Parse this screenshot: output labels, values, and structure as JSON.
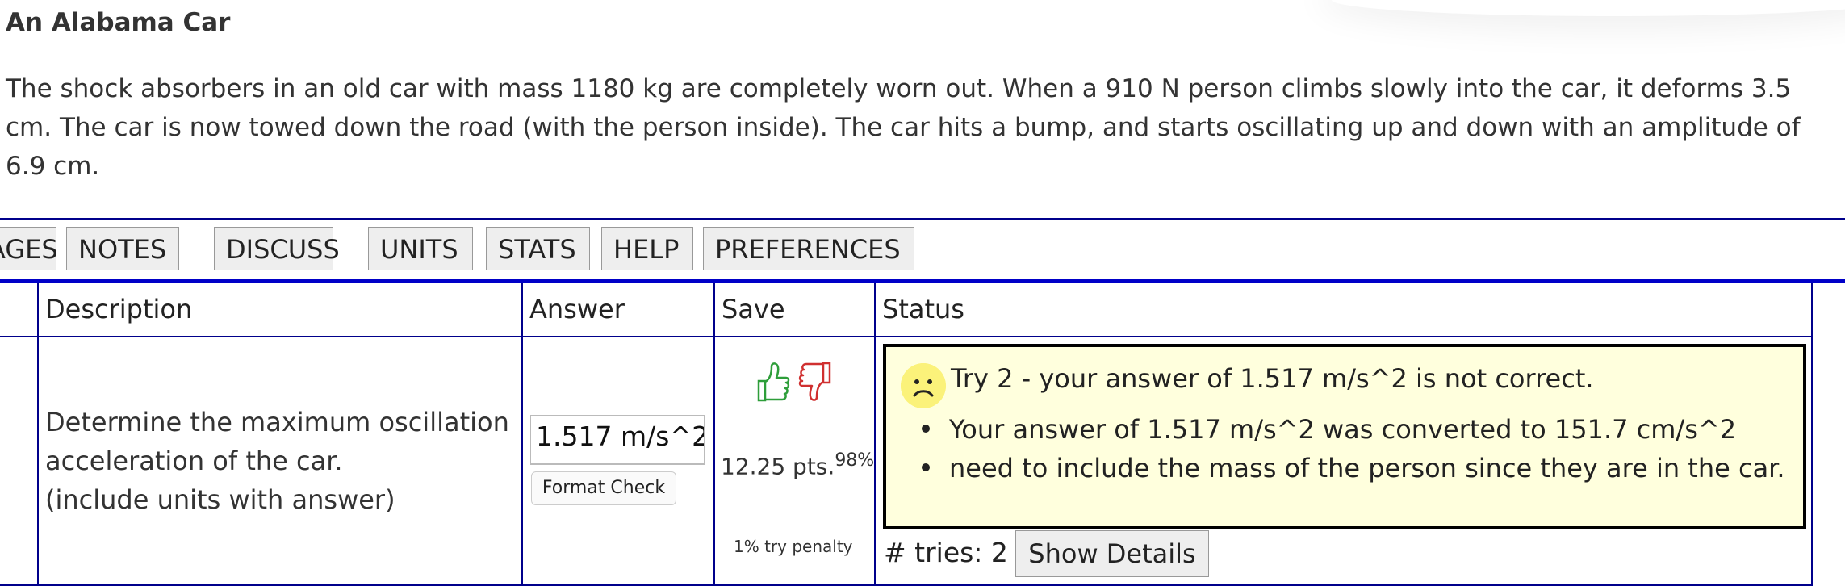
{
  "problem": {
    "title": "An Alabama Car",
    "text": "The shock absorbers in an old car with mass 1180 kg are completely worn out. When a 910 N person climbs slowly into the car, it deforms 3.5 cm. The car is now towed down the road (with the person inside). The car hits a bump, and starts oscillating up and down with an amplitude of 6.9 cm."
  },
  "tabs": [
    "AGES",
    "NOTES",
    "DISCUSS",
    "UNITS",
    "STATS",
    "HELP",
    "PREFERENCES"
  ],
  "table": {
    "headers": {
      "description": "Description",
      "answer": "Answer",
      "save": "Save",
      "status": "Status"
    },
    "row": {
      "description_line1": "Determine the maximum oscillation",
      "description_line2": "acceleration of the car.",
      "description_line3": "(include units with answer)",
      "answer_value": "1.517 m/s^2",
      "format_check_label": "Format Check",
      "points": "12.25 pts.",
      "percent": "98%",
      "penalty": "1% try penalty",
      "status": {
        "message": "Try 2 - your answer of 1.517 m/s^2 is not correct.",
        "bullets": [
          "Your answer of 1.517 m/s^2 was converted to 151.7 cm/s^2",
          "need to include the mass of the person since they are in the car."
        ]
      },
      "tries_label": "# tries: 2",
      "show_details_label": "Show Details"
    }
  },
  "colors": {
    "rule": "#00008b",
    "tab_rule": "#0000c8",
    "status_bg": "#ffffdd",
    "thumb_up": "#2e9e3a",
    "thumb_down": "#d03030",
    "face": "#fbf27a"
  },
  "icons": [
    "thumbs-up-icon",
    "thumbs-down-icon",
    "sad-face-icon"
  ]
}
